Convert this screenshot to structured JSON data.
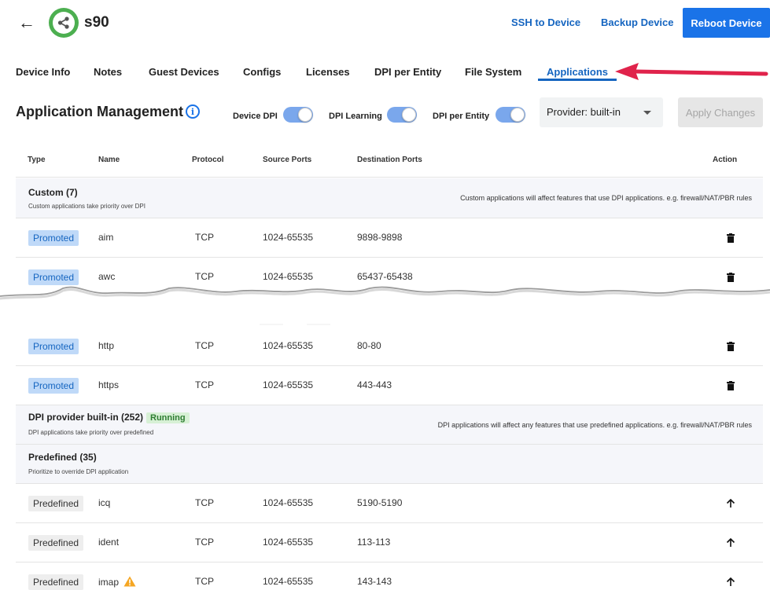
{
  "header": {
    "back_icon": "arrow-left-icon",
    "device_icon": "share-icon",
    "device_name": "s90",
    "ssh_label": "SSH to Device",
    "backup_label": "Backup Device",
    "reboot_label": "Reboot Device"
  },
  "tabs": [
    {
      "label": "Device Info"
    },
    {
      "label": "Notes"
    },
    {
      "label": "Guest Devices"
    },
    {
      "label": "Configs"
    },
    {
      "label": "Licenses"
    },
    {
      "label": "DPI per Entity"
    },
    {
      "label": "File System"
    },
    {
      "label": "Applications",
      "active": true
    }
  ],
  "toolbar": {
    "title": "Application Management",
    "info_icon": "info-icon",
    "toggles": [
      {
        "label": "Device DPI",
        "on": true
      },
      {
        "label": "DPI Learning",
        "on": true
      },
      {
        "label": "DPI per Entity",
        "on": true
      }
    ],
    "provider_value": "Provider: built-in",
    "apply_label": "Apply Changes"
  },
  "table": {
    "columns": [
      "Type",
      "Name",
      "Protocol",
      "Source Ports",
      "Destination Ports",
      "Action"
    ],
    "custom_group": {
      "title": "Custom (7)",
      "subtitle": "Custom applications take priority over DPI",
      "note": "Custom applications will affect features that use DPI applications. e.g. firewall/NAT/PBR rules"
    },
    "custom_rows": [
      {
        "type": "Promoted",
        "name": "aim",
        "protocol": "TCP",
        "src": "1024-65535",
        "dst": "9898-9898",
        "action_icon": "trash-icon"
      },
      {
        "type": "Promoted",
        "name": "awc",
        "protocol": "TCP",
        "src": "1024-65535",
        "dst": "65437-65438",
        "action_icon": "trash-icon"
      },
      {
        "type": "Promoted",
        "name": "http",
        "protocol": "TCP",
        "src": "1024-65535",
        "dst": "80-80",
        "action_icon": "trash-icon"
      },
      {
        "type": "Promoted",
        "name": "https",
        "protocol": "TCP",
        "src": "1024-65535",
        "dst": "443-443",
        "action_icon": "trash-icon"
      }
    ],
    "dpi_group": {
      "title": "DPI provider built-in (252)",
      "status": "Running",
      "subtitle": "DPI applications take priority over predefined",
      "note": "DPI applications will affect any features that use predefined applications. e.g. firewall/NAT/PBR rules"
    },
    "predefined_group": {
      "title": "Predefined (35)",
      "subtitle": "Prioritize to override DPI application"
    },
    "predefined_rows": [
      {
        "type": "Predefined",
        "name": "icq",
        "protocol": "TCP",
        "src": "1024-65535",
        "dst": "5190-5190",
        "action_icon": "arrow-up-icon"
      },
      {
        "type": "Predefined",
        "name": "ident",
        "protocol": "TCP",
        "src": "1024-65535",
        "dst": "113-113",
        "action_icon": "arrow-up-icon"
      },
      {
        "type": "Predefined",
        "name": "imap",
        "protocol": "TCP",
        "src": "1024-65535",
        "dst": "143-143",
        "action_icon": "arrow-up-icon",
        "warning": true
      }
    ]
  },
  "colors": {
    "primary": "#1a73e8",
    "link": "#1565c0",
    "logo_green": "#4caf50",
    "annotation_arrow": "#e0234b",
    "promoted_bg": "#bfd9f8",
    "running_bg": "#d7f0d5",
    "warning": "#f5a623"
  }
}
